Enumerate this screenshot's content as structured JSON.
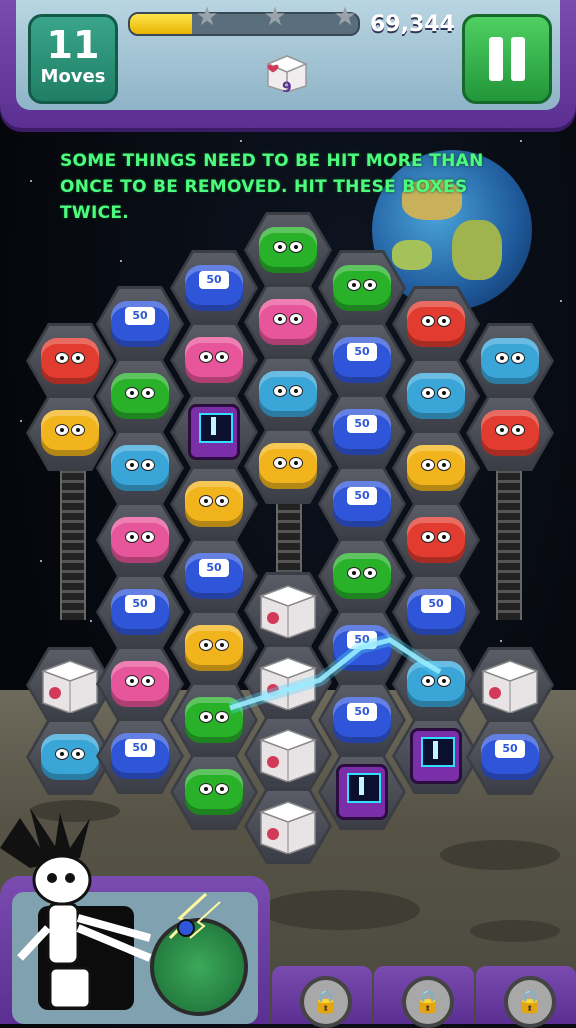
{
  "hud": {
    "moves_count": "11",
    "moves_label": "Moves",
    "score": "69,344",
    "goal_count": "9",
    "progress_fraction": 0.27,
    "star_icon": "star-icon",
    "pause_icon": "pause-icon"
  },
  "tip": {
    "text": "SOME THINGS NEED TO BE HIT MORE THAN ONCE TO BE REMOVED. HIT THESE BOXES TWICE."
  },
  "pieces_label": {
    "badge": "50"
  },
  "colors": {
    "red": "#e23b2f",
    "blue": "#2f56d8",
    "green": "#29b12a",
    "pink": "#e7559a",
    "cyan": "#3aa6d8",
    "yellow": "#f2b41c",
    "box": "#e8e4e6",
    "purple_frame": "#6a3a9f",
    "tip_green": "#4dfc7e"
  },
  "boosters": {
    "locked_icon": "lock-icon"
  }
}
